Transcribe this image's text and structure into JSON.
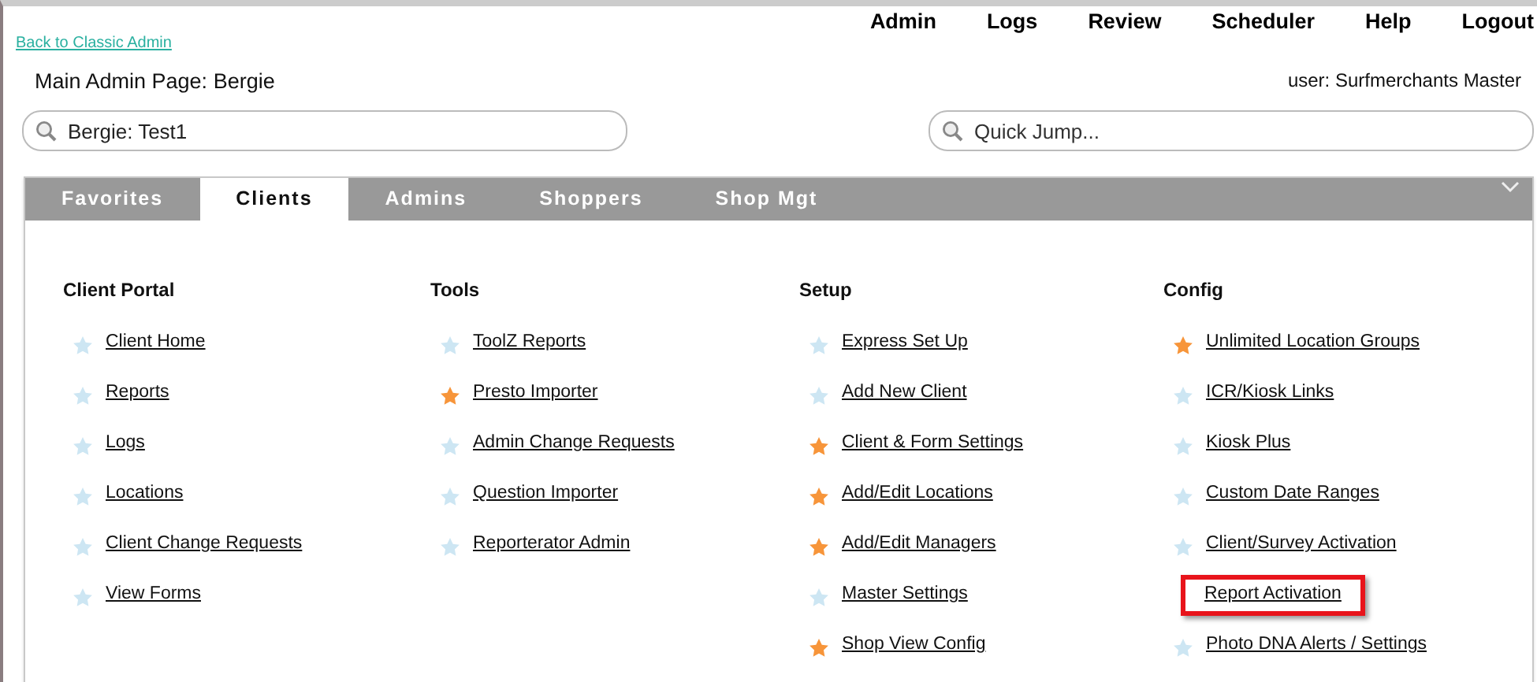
{
  "back_link": "Back to Classic Admin",
  "top_nav": [
    "Admin",
    "Logs",
    "Review",
    "Scheduler",
    "Help",
    "Logout"
  ],
  "page_title": "Main Admin Page: Bergie",
  "user": "user: Surfmerchants Master",
  "client_search": {
    "value": "Bergie: Test1"
  },
  "quick_jump": {
    "placeholder": "Quick Jump..."
  },
  "tabs": [
    {
      "label": "Favorites",
      "selected": false
    },
    {
      "label": "Clients",
      "selected": true
    },
    {
      "label": "Admins",
      "selected": false
    },
    {
      "label": "Shoppers",
      "selected": false
    },
    {
      "label": "Shop Mgt",
      "selected": false
    }
  ],
  "columns": [
    {
      "heading": "Client Portal",
      "links": [
        {
          "label": "Client Home",
          "favorite": false
        },
        {
          "label": "Reports",
          "favorite": false
        },
        {
          "label": "Logs",
          "favorite": false
        },
        {
          "label": "Locations",
          "favorite": false
        },
        {
          "label": "Client Change Requests",
          "favorite": false
        },
        {
          "label": "View Forms",
          "favorite": false
        }
      ]
    },
    {
      "heading": "Tools",
      "links": [
        {
          "label": "ToolZ Reports",
          "favorite": false
        },
        {
          "label": "Presto Importer",
          "favorite": true
        },
        {
          "label": "Admin Change Requests",
          "favorite": false
        },
        {
          "label": "Question Importer",
          "favorite": false
        },
        {
          "label": "Reporterator Admin",
          "favorite": false
        }
      ]
    },
    {
      "heading": "Setup",
      "links": [
        {
          "label": "Express Set Up",
          "favorite": false
        },
        {
          "label": "Add New Client",
          "favorite": false
        },
        {
          "label": "Client & Form Settings",
          "favorite": true
        },
        {
          "label": "Add/Edit Locations",
          "favorite": true
        },
        {
          "label": "Add/Edit Managers",
          "favorite": true
        },
        {
          "label": "Master Settings",
          "favorite": false
        },
        {
          "label": "Shop View Config",
          "favorite": true
        }
      ]
    },
    {
      "heading": "Config",
      "links": [
        {
          "label": "Unlimited Location Groups",
          "favorite": true
        },
        {
          "label": "ICR/Kiosk Links",
          "favorite": false
        },
        {
          "label": "Kiosk Plus",
          "favorite": false
        },
        {
          "label": "Custom Date Ranges",
          "favorite": false
        },
        {
          "label": "Client/Survey Activation",
          "favorite": false
        },
        {
          "label": "Report Activation",
          "highlighted": true
        },
        {
          "label": "Photo DNA Alerts / Settings",
          "favorite": false
        }
      ]
    }
  ]
}
